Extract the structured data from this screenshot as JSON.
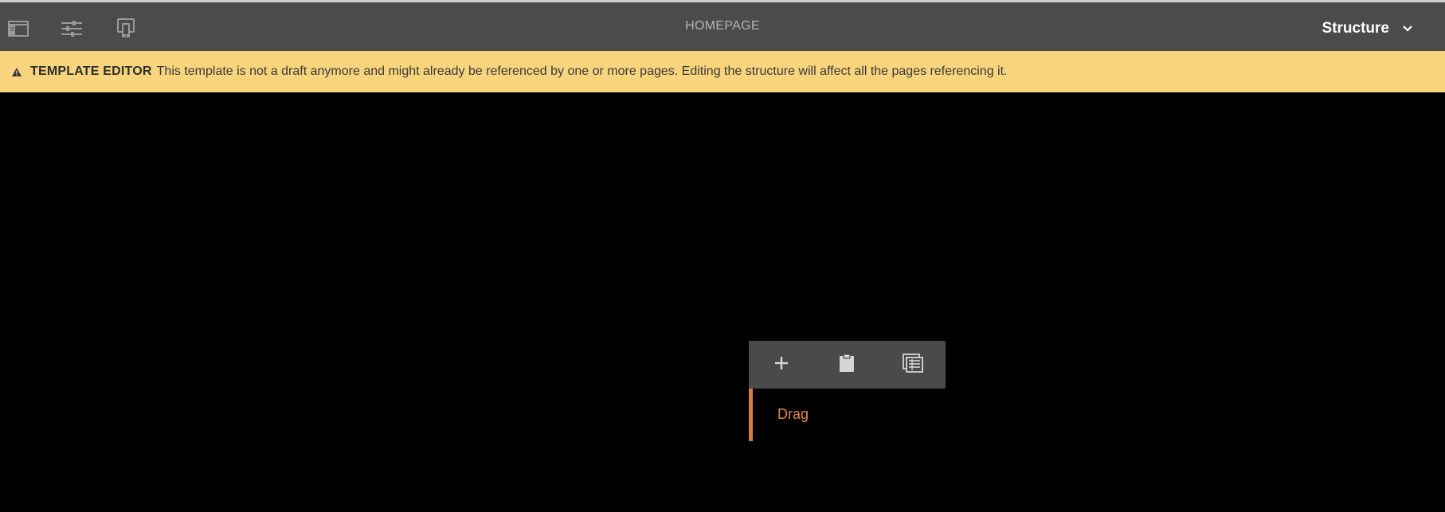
{
  "header": {
    "page_title": "HOMEPAGE",
    "mode_label": "Structure",
    "icons": [
      "toggle-side-panel-icon",
      "page-properties-icon",
      "emulator-icon"
    ]
  },
  "banner": {
    "title": "TEMPLATE EDITOR",
    "message": "This template is not a draft anymore and might already be referenced by one or more pages. Editing the structure will affect all the pages referencing it.",
    "icon": "warning-icon",
    "color": "#f8d47c"
  },
  "component_toolbar": {
    "icons": [
      "add-icon",
      "paste-icon",
      "policy-icon"
    ]
  },
  "drop_zone": {
    "label": "Drag",
    "accent": "#d97c42"
  },
  "colors": {
    "header_bg": "#4b4b4b",
    "canvas_bg": "#000000",
    "toolbar_bg": "#4a4a4a"
  }
}
